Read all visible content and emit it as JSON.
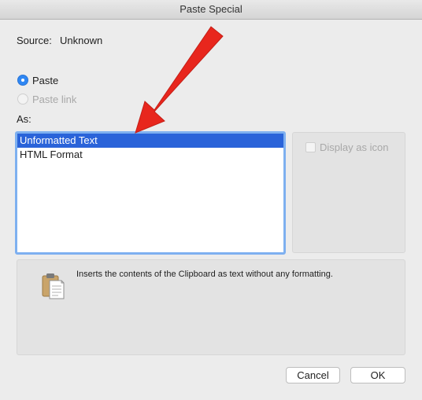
{
  "window": {
    "title": "Paste Special"
  },
  "source": {
    "label": "Source:",
    "value": "Unknown"
  },
  "options": [
    {
      "label": "Paste",
      "selected": true,
      "enabled": true
    },
    {
      "label": "Paste link",
      "selected": false,
      "enabled": false
    }
  ],
  "as_label": "As:",
  "formats": [
    {
      "label": "Unformatted Text",
      "selected": true
    },
    {
      "label": "HTML Format",
      "selected": false
    }
  ],
  "display_as_icon": {
    "label": "Display as icon",
    "checked": false,
    "enabled": false
  },
  "result": {
    "icon": "clipboard-icon",
    "text": "Inserts the contents of the Clipboard as text without any formatting."
  },
  "buttons": {
    "cancel": "Cancel",
    "ok": "OK"
  },
  "colors": {
    "accent": "#2f87f3",
    "selection": "#2a63d9",
    "annotation_arrow": "#e8261d"
  }
}
